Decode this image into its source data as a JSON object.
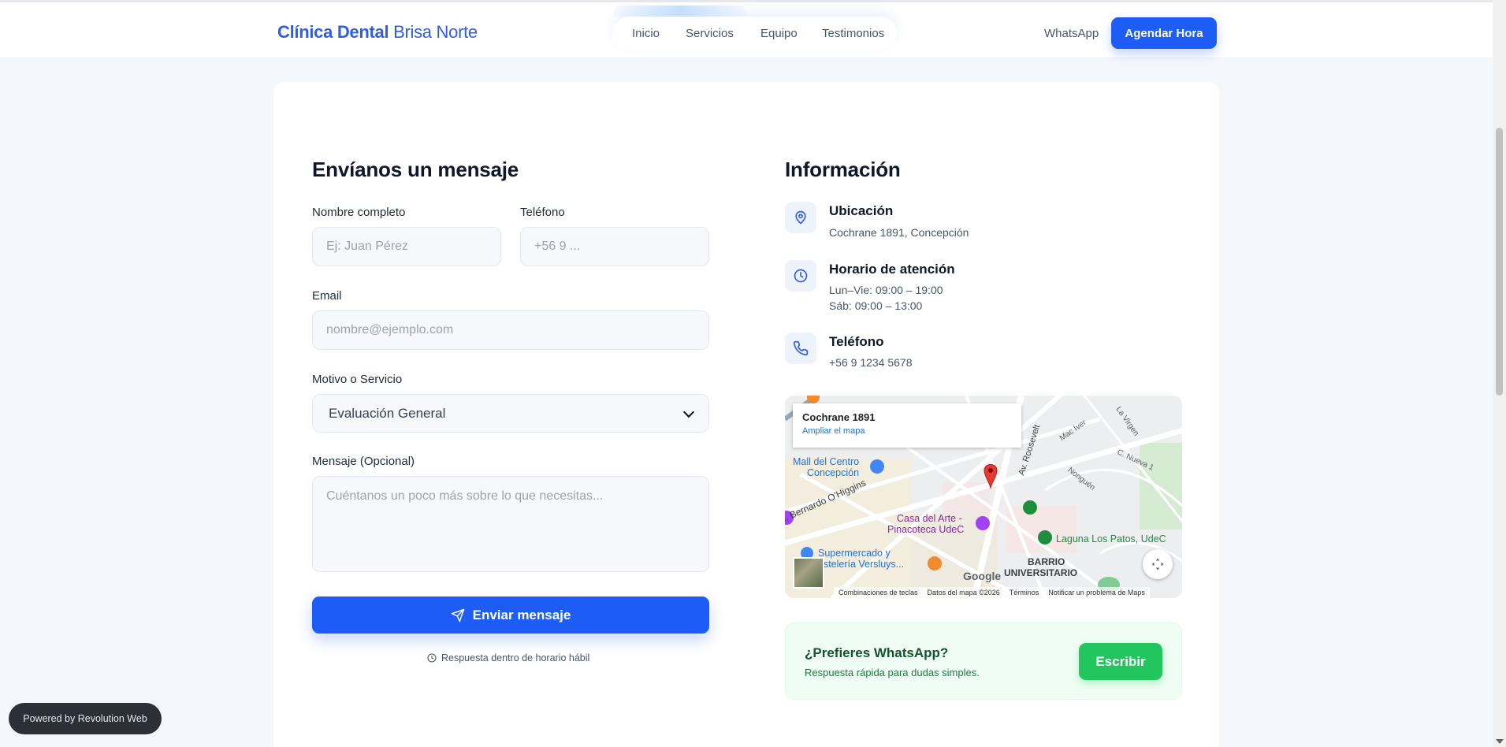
{
  "header": {
    "brand_bold": "Clínica Dental",
    "brand_light": "Brisa Norte",
    "nav": [
      "Inicio",
      "Servicios",
      "Equipo",
      "Testimonios"
    ],
    "whatsapp_link": "WhatsApp",
    "cta_label": "Agendar Hora"
  },
  "form": {
    "title": "Envíanos un mensaje",
    "name_label": "Nombre completo",
    "name_placeholder": "Ej: Juan Pérez",
    "phone_label": "Teléfono",
    "phone_placeholder": "+56 9 ...",
    "email_label": "Email",
    "email_placeholder": "nombre@ejemplo.com",
    "service_label": "Motivo o Servicio",
    "service_value": "Evaluación General",
    "message_label": "Mensaje (Opcional)",
    "message_placeholder": "Cuéntanos un poco más sobre lo que necesitas...",
    "submit_label": "Enviar mensaje",
    "response_note": "Respuesta dentro de horario hábil"
  },
  "info": {
    "title": "Información",
    "location_title": "Ubicación",
    "location_text": "Cochrane 1891, Concepción",
    "hours_title": "Horario de atención",
    "hours_weekdays": "Lun–Vie: 09:00 – 19:00",
    "hours_saturday": "Sáb: 09:00 – 13:00",
    "phone_title": "Teléfono",
    "phone_text": "+56 9 1234 5678"
  },
  "map": {
    "place_name": "Cochrane 1891",
    "enlarge_link": "Ampliar el mapa",
    "labels": {
      "mall": "Mall del Centro",
      "mall2": "Concepción",
      "casa_arte": "Casa del Arte -",
      "pinacoteca": "Pinacoteca UdeC",
      "laguna": "Laguna Los Patos, UdeC",
      "barrio": "BARRIO",
      "universitario": "UNIVERSITARIO",
      "supermercado": "Supermercado y",
      "pasteleria": "astelería Versluys...",
      "ohiggins": "al. Bernardo O'Higgins",
      "roosevelt": "Av. Roosevelt",
      "macive": "Mac Iver",
      "lavirgen": "La Virgen",
      "nueva": "C. Nueva 1",
      "nonguen": "Nonguén",
      "google": "Google"
    },
    "footer": [
      "Combinaciones de teclas",
      "Datos del mapa ©2026",
      "Términos",
      "Notificar un problema de Maps"
    ]
  },
  "whatsapp_box": {
    "question": "¿Prefieres WhatsApp?",
    "subtitle": "Respuesta rápida para dudas simples.",
    "button_label": "Escribir"
  },
  "powered_by": "Powered by Revolution Web",
  "colors": {
    "primary": "#1d5cf5",
    "whatsapp": "#22c55e",
    "brand": "#2f5fe0"
  }
}
